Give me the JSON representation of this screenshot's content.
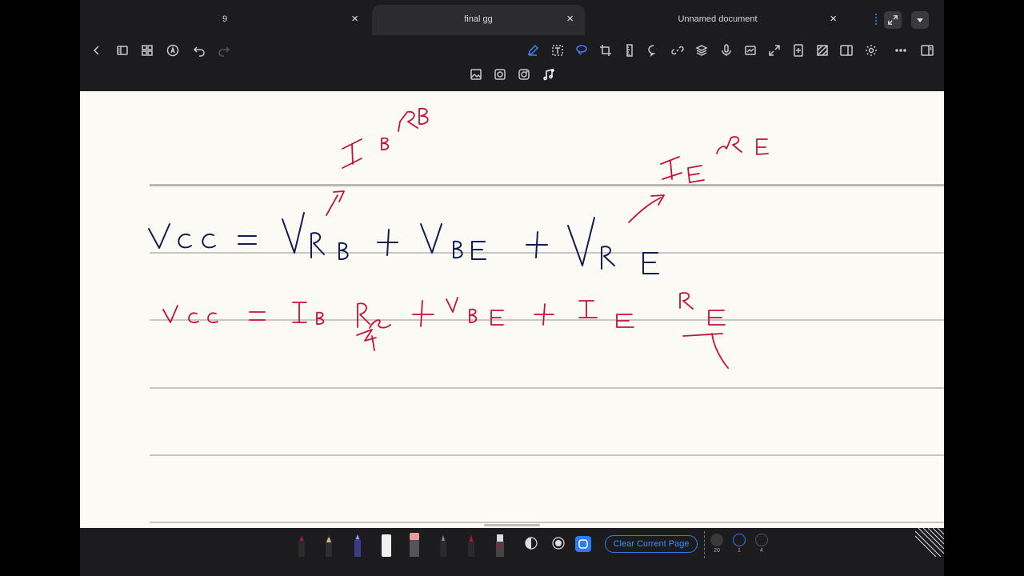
{
  "tabs": [
    {
      "label": "9",
      "active": false
    },
    {
      "label": "final gg",
      "active": true
    },
    {
      "label": "Unnamed document",
      "active": false
    }
  ],
  "tab_close_glyph": "×",
  "bottom_bar": {
    "clear_button_label": "Clear Current Page",
    "stroke_sizes": [
      "20",
      "1",
      "4"
    ]
  },
  "handwriting": {
    "ink_red": "#c4123a",
    "ink_navy": "#121c52",
    "line1": "Vcc = VRB + VBE + VRE",
    "line2": "Vcc = IB RB + VBE + IE RE",
    "note_left": "IB RB",
    "note_right": "IE RE"
  },
  "icons": {
    "tabbar": [
      "fullscreen-icon",
      "dropdown-icon"
    ],
    "toolbar_left": [
      "back-icon",
      "sidebar-icon",
      "grid-icon",
      "pen-circle-icon",
      "undo-icon",
      "redo-icon"
    ],
    "toolbar_right": [
      "pen-icon",
      "text-icon",
      "lasso-icon",
      "crop-icon",
      "ruler-icon",
      "comment-icon",
      "link-icon",
      "layers-icon",
      "mic-icon",
      "scan-icon",
      "expand-icon",
      "add-page-icon",
      "pattern-icon",
      "split-view-icon",
      "settings-icon",
      "more-icon",
      "panel-icon"
    ],
    "toolbar_second_row": [
      "image-icon",
      "sticker-icon",
      "camera-icon",
      "audio-icon"
    ]
  }
}
